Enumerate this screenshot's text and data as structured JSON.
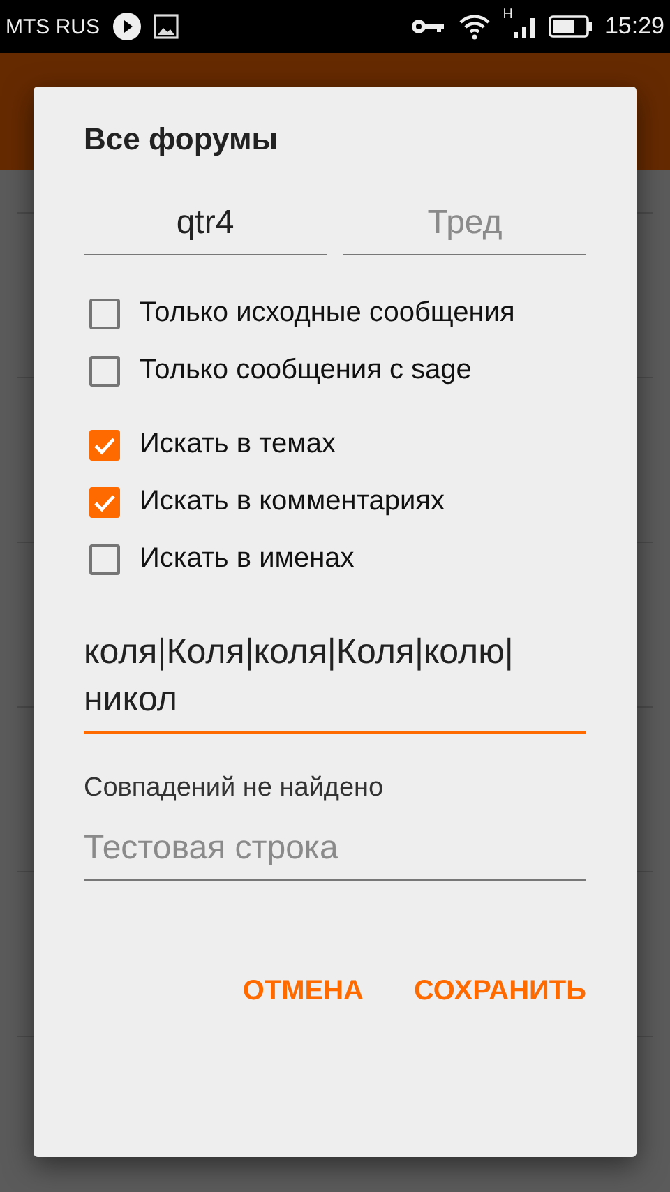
{
  "status_bar": {
    "carrier": "MTS RUS",
    "network_type": "H",
    "time": "15:29"
  },
  "dialog": {
    "title": "Все форумы",
    "board_field": {
      "value": "qtr4"
    },
    "thread_field": {
      "placeholder": "Тред"
    },
    "options": [
      {
        "label": "Только исходные сообщения",
        "checked": false
      },
      {
        "label": "Только сообщения с sage",
        "checked": false
      },
      {
        "label": "Искать в темах",
        "checked": true
      },
      {
        "label": "Искать в комментариях",
        "checked": true
      },
      {
        "label": "Искать в именах",
        "checked": false
      }
    ],
    "pattern_field": {
      "value": "коля|Коля|коля|Коля|колю|никол"
    },
    "match_status": "Совпадений не найдено",
    "test_field": {
      "placeholder": "Тестовая строка"
    },
    "buttons": [
      "ОТМЕНА",
      "СОХРАНИТЬ"
    ]
  }
}
